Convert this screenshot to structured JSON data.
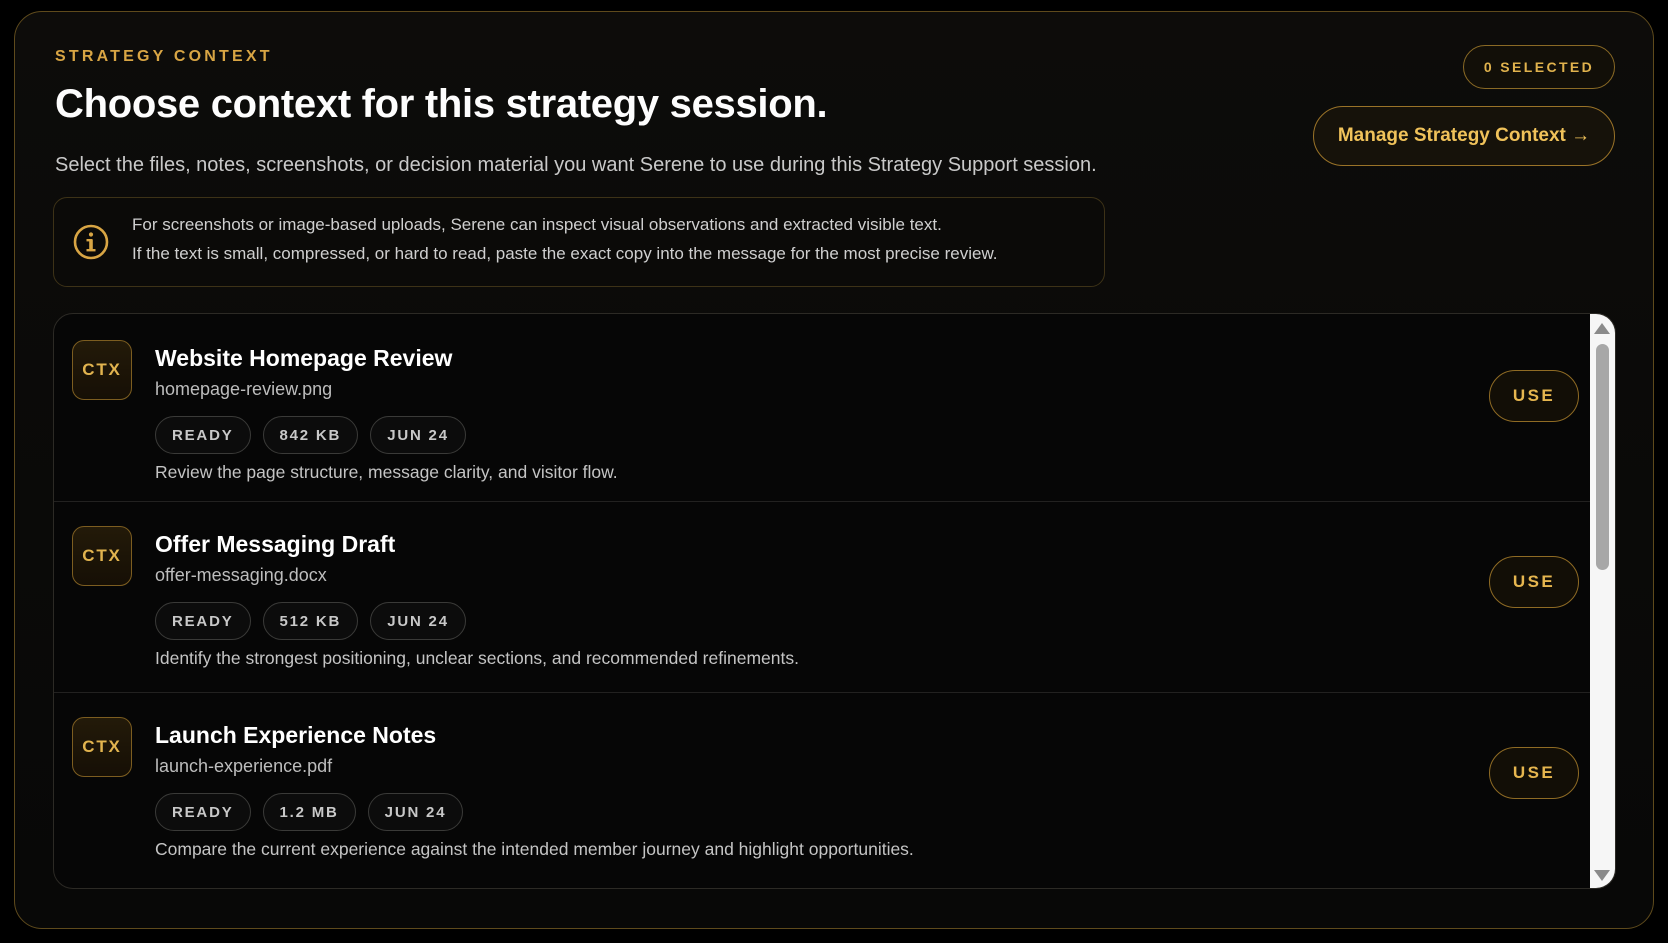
{
  "header": {
    "eyebrow": "STRATEGY CONTEXT",
    "title": "Choose context for this strategy session.",
    "subtitle": "Select the files, notes, screenshots, or decision material you want Serene to use during this Strategy Support session.",
    "selected_badge": "0 SELECTED",
    "manage_button": "Manage Strategy Context →"
  },
  "notice": {
    "icon": "info-circle-icon",
    "line1": "For screenshots or image-based uploads, Serene can inspect visual observations and extracted visible text.",
    "line2": "If the text is small, compressed, or hard to read, paste the exact copy into the message for the most precise review."
  },
  "items": [
    {
      "icon_label": "CTX",
      "title": "Website Homepage Review",
      "file": "homepage-review.png",
      "status": "READY",
      "size": "842 KB",
      "date": "JUN 24",
      "description": "Review the page structure, message clarity, and visitor flow.",
      "action": "USE"
    },
    {
      "icon_label": "CTX",
      "title": "Offer Messaging Draft",
      "file": "offer-messaging.docx",
      "status": "READY",
      "size": "512 KB",
      "date": "JUN 24",
      "description": "Identify the strongest positioning, unclear sections, and recommended refinements.",
      "action": "USE"
    },
    {
      "icon_label": "CTX",
      "title": "Launch Experience Notes",
      "file": "launch-experience.pdf",
      "status": "READY",
      "size": "1.2 MB",
      "date": "JUN 24",
      "description": "Compare the current experience against the intended member journey and highlight opportunities.",
      "action": "USE"
    }
  ],
  "colors": {
    "accent": "#d8a544",
    "background": "#0a0a09",
    "border": "#5e4a1c"
  }
}
